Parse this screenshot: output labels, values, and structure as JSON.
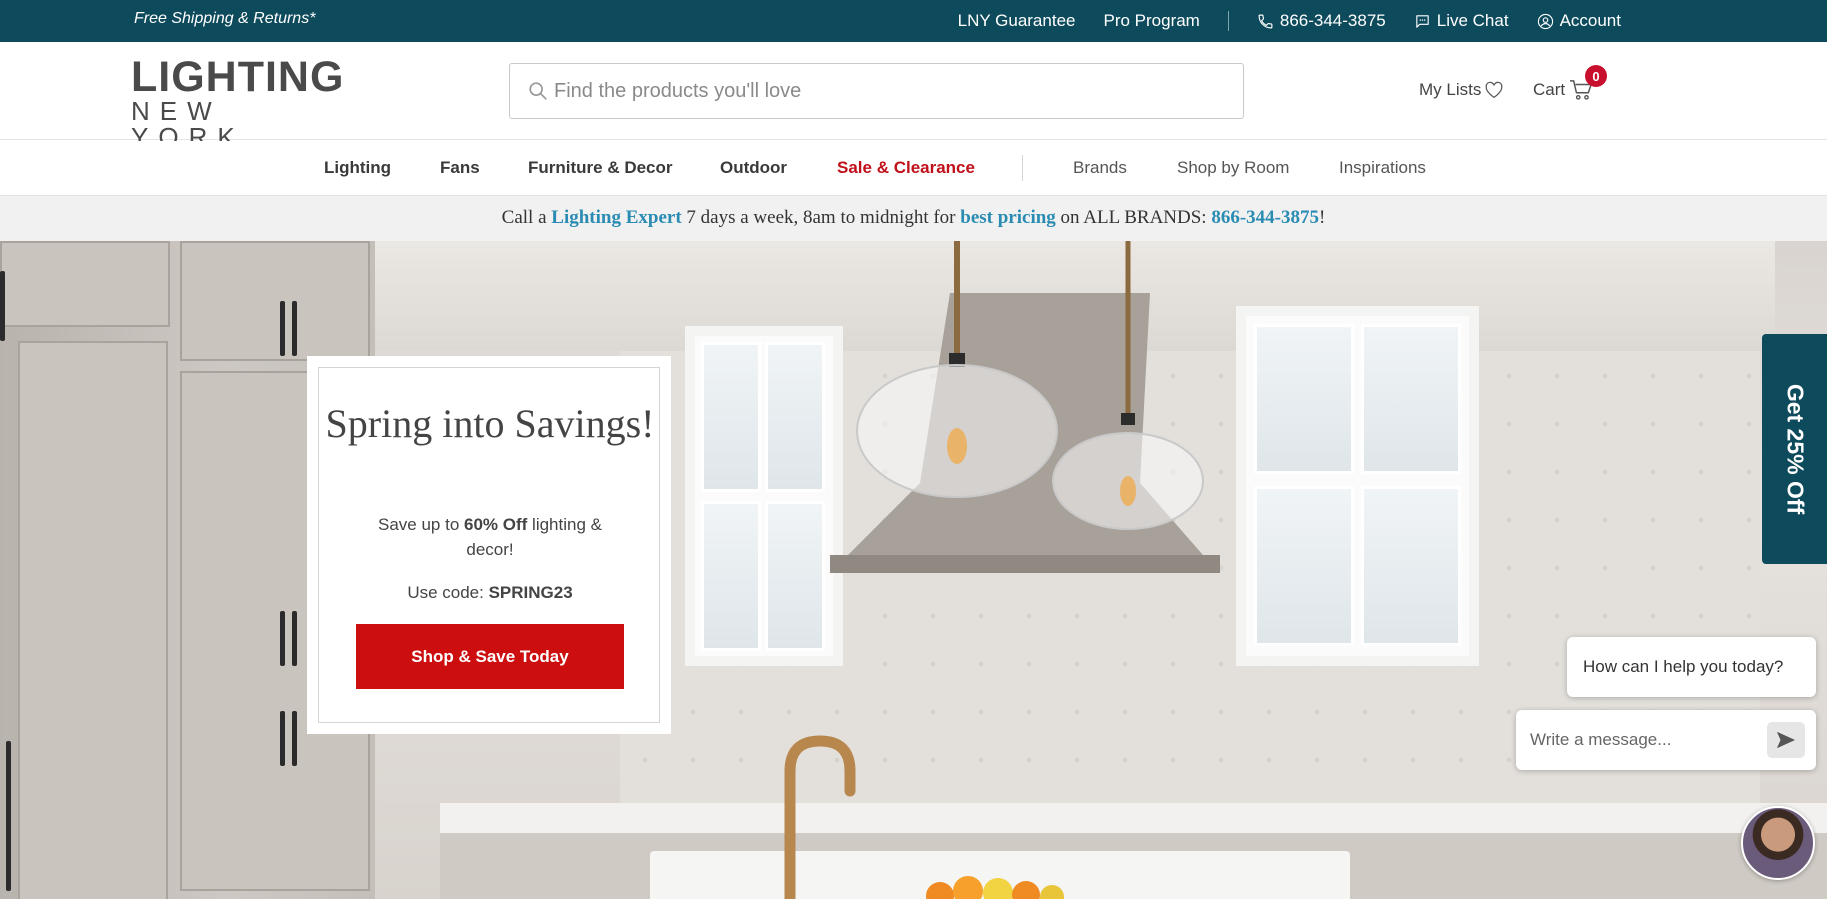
{
  "topbar": {
    "shipping": "Free Shipping & Returns*",
    "guarantee": "LNY Guarantee",
    "pro": "Pro Program",
    "phone": "866-344-3875",
    "chat": "Live Chat",
    "account": "Account"
  },
  "header": {
    "logo_line1": "LIGHTING",
    "logo_line2": "NEW YORK",
    "search_placeholder": "Find the products you'll love",
    "my_lists": "My Lists",
    "cart": "Cart",
    "cart_count": "0"
  },
  "nav": {
    "items": [
      {
        "label": "Lighting"
      },
      {
        "label": "Fans"
      },
      {
        "label": "Furniture & Decor"
      },
      {
        "label": "Outdoor"
      },
      {
        "label": "Sale & Clearance"
      },
      {
        "label": "Brands"
      },
      {
        "label": "Shop by Room"
      },
      {
        "label": "Inspirations"
      }
    ]
  },
  "strip": {
    "t1": "Call a ",
    "expert": "Lighting Expert",
    "t2": " 7 days a week, 8am to midnight for ",
    "pricing": "best pricing",
    "t3": " on ALL BRANDS: ",
    "phone": "866-344-3875",
    "t4": "!"
  },
  "promo": {
    "title": "Spring into Savings!",
    "save_pre": "Save up to ",
    "save_bold": "60% Off",
    "save_post": " lighting & decor!",
    "code_pre": "Use code: ",
    "code": "SPRING23",
    "button": "Shop & Save Today"
  },
  "sidetab": "Get 25% Off",
  "chat": {
    "bubble": "How can I help you today?",
    "placeholder": "Write a message..."
  },
  "colors": {
    "brand_teal": "#0d4a5c",
    "sale_red": "#c0101a",
    "button_red": "#cc0e0e",
    "link_blue": "#2a8cb3"
  }
}
